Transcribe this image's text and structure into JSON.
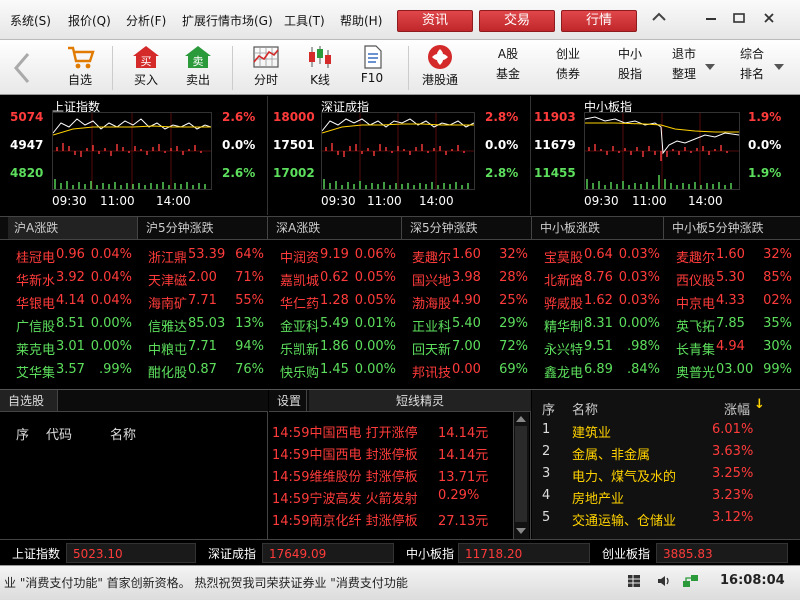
{
  "menu": {
    "items": [
      "系统(S)",
      "报价(Q)",
      "分析(F)",
      "扩展行情市场(G)",
      "工具(T)",
      "帮助(H)"
    ],
    "buttons": [
      "资讯",
      "交易",
      "行情"
    ]
  },
  "toolbar": {
    "buttons": [
      "自选",
      "买入",
      "卖出",
      "分时",
      "K线",
      "F10",
      "港股通"
    ],
    "group_a": [
      "A股",
      "基金"
    ],
    "group_b": [
      "创业",
      "债券"
    ],
    "group_c": [
      "中小",
      "股指"
    ],
    "delist": [
      "退市",
      "整理"
    ],
    "composite": [
      "综合",
      "排名"
    ]
  },
  "index_panels": [
    {
      "title": "上证指数",
      "y_top": "5074",
      "y_mid": "4947",
      "y_bot": "4820",
      "r_top": "2.6%",
      "r_mid": "0.0%",
      "r_bot": "2.6%",
      "times": [
        "09:30",
        "11:00",
        "14:00"
      ]
    },
    {
      "title": "深证成指",
      "y_top": "18000",
      "y_mid": "17501",
      "y_bot": "17002",
      "r_top": "2.8%",
      "r_mid": "0.0%",
      "r_bot": "2.8%",
      "times": [
        "09:30",
        "11:00",
        "14:00"
      ]
    },
    {
      "title": "中小板指",
      "y_top": "11903",
      "y_mid": "11679",
      "y_bot": "11455",
      "r_top": "1.9%",
      "r_mid": "0.0%",
      "r_bot": "1.9%",
      "times": [
        "09:30",
        "11:00",
        "14:00"
      ]
    }
  ],
  "rank_tabs": [
    "沪A涨跌",
    "沪5分钟涨跌",
    "深A涨跌",
    "深5分钟涨跌",
    "中小板涨跌",
    "中小板5分钟涨跌"
  ],
  "rank_columns": [
    [
      [
        "桂冠电",
        "0.96",
        "0.04%",
        "r"
      ],
      [
        "华新水",
        "3.92",
        "0.04%",
        "r"
      ],
      [
        "华银电",
        "4.14",
        "0.04%",
        "r"
      ],
      [
        "广信股",
        "8.51",
        "0.00%",
        "g"
      ],
      [
        "莱克电",
        "3.01",
        "0.00%",
        "g"
      ],
      [
        "艾华集",
        "3.57",
        ".99%",
        "g"
      ]
    ],
    [
      [
        "浙江鼎",
        "53.39",
        "64%",
        "r"
      ],
      [
        "天津磁",
        "2.00",
        "71%",
        "r"
      ],
      [
        "海南矿",
        "7.71",
        "55%",
        "r"
      ],
      [
        "信雅达",
        "85.03",
        "13%",
        "g"
      ],
      [
        "中粮屯",
        "7.71",
        "94%",
        "g"
      ],
      [
        "酣化股",
        "0.87",
        "76%",
        "g"
      ]
    ],
    [
      [
        "中润资",
        "9.19",
        "0.06%",
        "r"
      ],
      [
        "嘉凯城",
        "0.62",
        "0.05%",
        "r"
      ],
      [
        "华仁药",
        "1.28",
        "0.05%",
        "r"
      ],
      [
        "金亚科",
        "5.49",
        "0.01%",
        "g"
      ],
      [
        "乐凯新",
        "1.86",
        "0.00%",
        "g"
      ],
      [
        "快乐购",
        "1.45",
        "0.00%",
        "g"
      ]
    ],
    [
      [
        "麦趣尔",
        "1.60",
        "32%",
        "r"
      ],
      [
        "国兴地",
        "3.98",
        "28%",
        "r"
      ],
      [
        "渤海股",
        "4.90",
        "25%",
        "r"
      ],
      [
        "正业科",
        "5.40",
        "29%",
        "g"
      ],
      [
        "回天新",
        "7.00",
        "72%",
        "g"
      ],
      [
        "邦讯技",
        "0.00",
        "69%",
        "g"
      ]
    ],
    [
      [
        "宝莫股",
        "0.64",
        "0.03%",
        "r"
      ],
      [
        "北新路",
        "8.76",
        "0.03%",
        "r"
      ],
      [
        "骅威股",
        "1.62",
        "0.03%",
        "r"
      ],
      [
        "精华制",
        "8.31",
        "0.00%",
        "g"
      ],
      [
        "永兴特",
        "9.51",
        ".98%",
        "g"
      ],
      [
        "鑫龙电",
        "6.89",
        ".84%",
        "g"
      ]
    ],
    [
      [
        "麦趣尔",
        "1.60",
        "32%",
        "r"
      ],
      [
        "西仪股",
        "5.30",
        "85%",
        "r"
      ],
      [
        "中京电",
        "4.33",
        "02%",
        "r"
      ],
      [
        "英飞拓",
        "7.85",
        "35%",
        "g"
      ],
      [
        "长青集",
        "4.94",
        "30%",
        "g"
      ],
      [
        "奥普光",
        "03.00",
        "99%",
        "g"
      ]
    ]
  ],
  "watchlist": {
    "tab": "自选股",
    "cols": [
      "序",
      "代码",
      "名称"
    ]
  },
  "shortline": {
    "tab_settings": "设置",
    "tab_title": "短线精灵",
    "rows": [
      [
        "14:59",
        "中国西电",
        "打开涨停",
        "14.14元"
      ],
      [
        "14:59",
        "中国西电",
        "封涨停板",
        "14.14元"
      ],
      [
        "14:59",
        "维维股份",
        "封涨停板",
        "13.71元"
      ],
      [
        "14:59",
        "宁波高发",
        "火箭发射",
        "0.29%"
      ],
      [
        "14:59",
        "南京化纤",
        "封涨停板",
        "27.13元"
      ]
    ]
  },
  "sector": {
    "headers": [
      "序",
      "名称",
      "涨幅"
    ],
    "sort_arrow": "↓",
    "rows": [
      [
        "1",
        "建筑业",
        "6.01%"
      ],
      [
        "2",
        "金属、非金属",
        "3.63%"
      ],
      [
        "3",
        "电力、煤气及水的",
        "3.25%"
      ],
      [
        "4",
        "房地产业",
        "3.23%"
      ],
      [
        "5",
        "交通运输、仓储业",
        "3.12%"
      ]
    ]
  },
  "status": [
    {
      "label": "上证指数",
      "value": "5023.10"
    },
    {
      "label": "深证成指",
      "value": "17649.09"
    },
    {
      "label": "中小板指",
      "value": "11718.20"
    },
    {
      "label": "创业板指",
      "value": "3885.83"
    }
  ],
  "ticker": {
    "text": "业 \"消费支付功能\" 首家创新资格。 热烈祝贺我司荣获证券业 \"消费支付功能",
    "time": "16:08:04"
  },
  "colors": {
    "up": "#ff3b3b",
    "down": "#5ddf5d",
    "accent": "#c0272b"
  }
}
